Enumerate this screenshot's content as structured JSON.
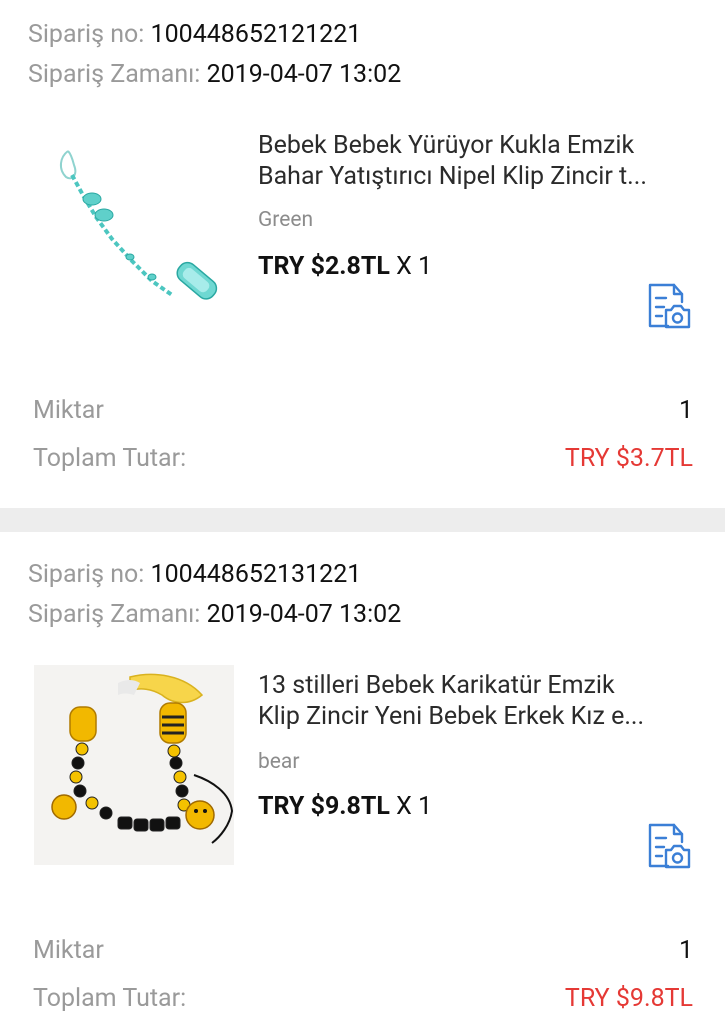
{
  "labels": {
    "order_no": "Sipariş no:",
    "order_time": "Sipariş Zamanı:",
    "quantity": "Miktar",
    "total": "Toplam Tutar:"
  },
  "orders": [
    {
      "order_no": "100448652121221",
      "order_time": "2019-04-07 13:02",
      "title_line1": "Bebek Bebek Yürüyor Kukla Emzik",
      "title_line2": "Bahar Yatıştırıcı Nipel Klip Zincir t...",
      "variant": "Green",
      "price": "TRY $2.8TL",
      "qty_suffix": "X 1",
      "quantity": "1",
      "total": "TRY $3.7TL",
      "thumb_icon": "pacifier-clip-chain-photo",
      "action_icon": "write-review-photo-icon"
    },
    {
      "order_no": "100448652131221",
      "order_time": "2019-04-07 13:02",
      "title_line1": "13 stilleri Bebek Karikatür Emzik",
      "title_line2": "Klip Zincir Yeni Bebek Erkek Kız e...",
      "variant": "bear",
      "price": "TRY $9.8TL",
      "qty_suffix": "X 1",
      "quantity": "1",
      "total": "TRY $9.8TL",
      "thumb_icon": "bee-pacifier-chain-photo",
      "action_icon": "write-review-photo-icon"
    }
  ],
  "colors": {
    "accent_red": "#e53935",
    "icon_blue": "#3b7fd6",
    "label_gray": "#9a9a9a",
    "separator": "#ededed"
  }
}
